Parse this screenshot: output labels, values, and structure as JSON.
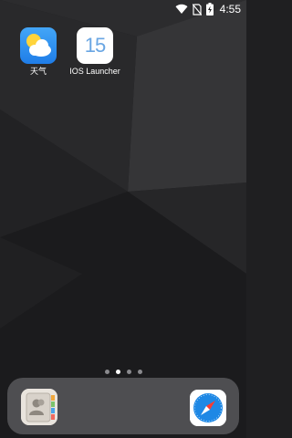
{
  "status_bar": {
    "time": "4:55",
    "icons": [
      "wifi-icon",
      "no-sim-icon",
      "battery-charging-icon"
    ]
  },
  "home_apps": [
    {
      "label": "天气",
      "icon": "weather-icon"
    },
    {
      "label": "IOS Launcher",
      "icon": "ios-15-icon",
      "icon_text": "15"
    }
  ],
  "page_dots": {
    "count": 4,
    "active_index": 1
  },
  "dock": {
    "apps": [
      {
        "name": "contacts",
        "icon": "contacts-icon"
      },
      {
        "name": "safari",
        "icon": "safari-icon"
      }
    ]
  },
  "colors": {
    "wallpaper": "#1f1f21",
    "weather_blue": "#2f8ff0",
    "launcher_number": "#6aa6e3",
    "safari_blue": "#1e88e5"
  }
}
